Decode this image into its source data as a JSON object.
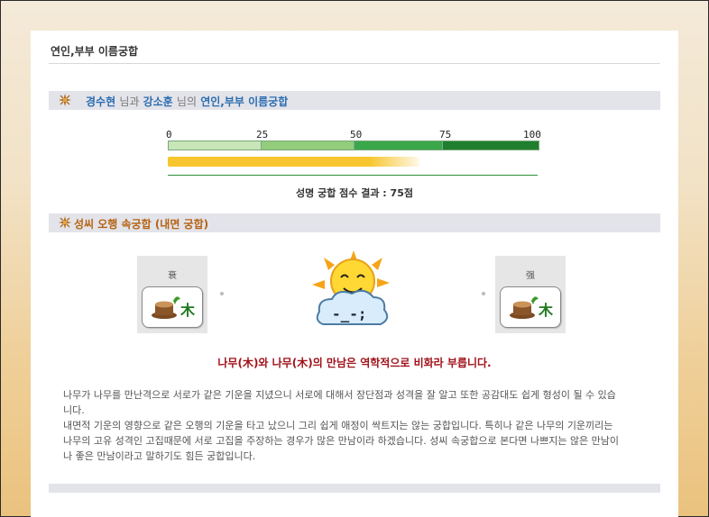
{
  "page": {
    "title": "연인,부부 이름궁합"
  },
  "header": {
    "name1": "경수현",
    "conj1": "님과",
    "name2": "강소훈",
    "conj2": "님의",
    "subject": "연인,부부 이름궁합"
  },
  "score": {
    "ticks": [
      "0",
      "25",
      "50",
      "75",
      "100"
    ],
    "value": 75,
    "result_text": "성명 궁합 점수 결과 : 75점"
  },
  "section2": {
    "title": "성씨 오행 속궁합 (내면 궁합)"
  },
  "elements": {
    "left_label": "衰",
    "left_char": "木",
    "right_label": "强",
    "right_char": "木",
    "emoticon": "-_-;"
  },
  "verdict": "나무(木)와 나무(木)의 만남은 역학적으로 비화라 부릅니다.",
  "description": [
    "나무가 나무를 만난격으로 서로가 같은 기운을 지녔으니 서로에 대해서 장단점과 성격을 잘 알고 또한 공감대도 쉽게 형성이 될 수 있습니다.",
    "내면적 기운의 영향으로 같은 오행의 기운을 타고 났으니 그리 쉽게 애정이 싹트지는 않는 궁합입니다. 특히나 같은 나무의 기운끼리는 나무의 고유 성격인 고집때문에 서로 고집을 주장하는 경우가 많은 만남이라 하겠습니다. 성씨 속궁합으로 본다면 나쁘지는 않은 만남이나 좋은 만남이라고 말하기도 힘든 궁합입니다."
  ],
  "colors": {
    "accent_blue": "#2b6db0",
    "accent_orange": "#b56312",
    "verdict_red": "#a0121a",
    "meter_yellow": "#f7c52d"
  }
}
